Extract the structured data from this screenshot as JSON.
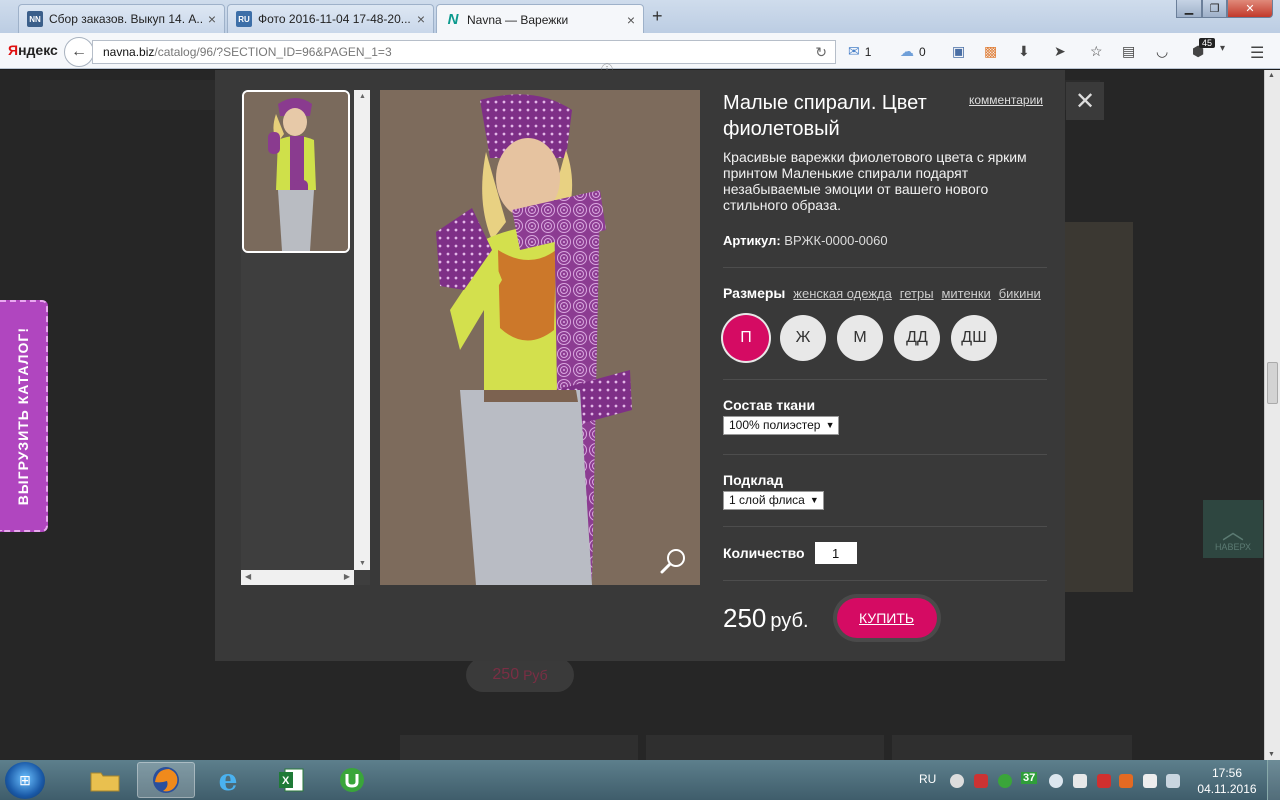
{
  "browser": {
    "tabs": [
      {
        "favicon": "NN",
        "label": "Сбор заказов. Выкуп 14. А...",
        "favcolor": "#3b5f8a"
      },
      {
        "favicon": "RU",
        "label": "Фото 2016-11-04 17-48-20....",
        "favcolor": "#3d6fa8"
      },
      {
        "favicon": "N",
        "label": "Navna — Варежки",
        "favcolor": "#0c9a8e"
      }
    ],
    "yandex_red": "Я",
    "yandex_rest": "ндекс",
    "url_host": "navna.biz",
    "url_path": "/catalog/96/?SECTION_ID=96&PAGEN_1=3",
    "mail_count": "1",
    "weather_count": "0",
    "ext_badge": "45"
  },
  "page": {
    "side_tab_label": "ВЫГРУЗИТЬ КАТАЛОГ!",
    "bg_price": "250",
    "bg_price_unit": "Руб",
    "up_button_label": "НАВЕРХ"
  },
  "product": {
    "title": "Малые спирали. Цвет фиолетовый",
    "comments_link": "комментарии",
    "description": "Красивые варежки фиолетового цвета с ярким принтом Маленькие спирали подарят незабываемые эмоции от вашего нового стильного образа.",
    "sku_label": "Артикул:",
    "sku_value": "ВРЖК-0000-0060",
    "sizes_label": "Размеры",
    "size_links": [
      "женская одежда",
      "гетры",
      "митенки",
      "бикини"
    ],
    "sizes": [
      "П",
      "Ж",
      "М",
      "ДД",
      "ДШ"
    ],
    "selected_size": "П",
    "fabric_label": "Состав ткани",
    "fabric_value": "100% полиэстер",
    "lining_label": "Подклад",
    "lining_value": "1 слой флиса",
    "quantity_label": "Количество",
    "quantity_value": "1",
    "price": "250",
    "price_unit": "руб.",
    "buy_label": "КУПИТЬ"
  },
  "taskbar": {
    "lang": "RU",
    "tray_count": "37",
    "time": "17:56",
    "date": "04.11.2016"
  },
  "colors": {
    "accent": "#d50b63",
    "modal_bg": "#393939",
    "side_tab": "#b046bf"
  }
}
